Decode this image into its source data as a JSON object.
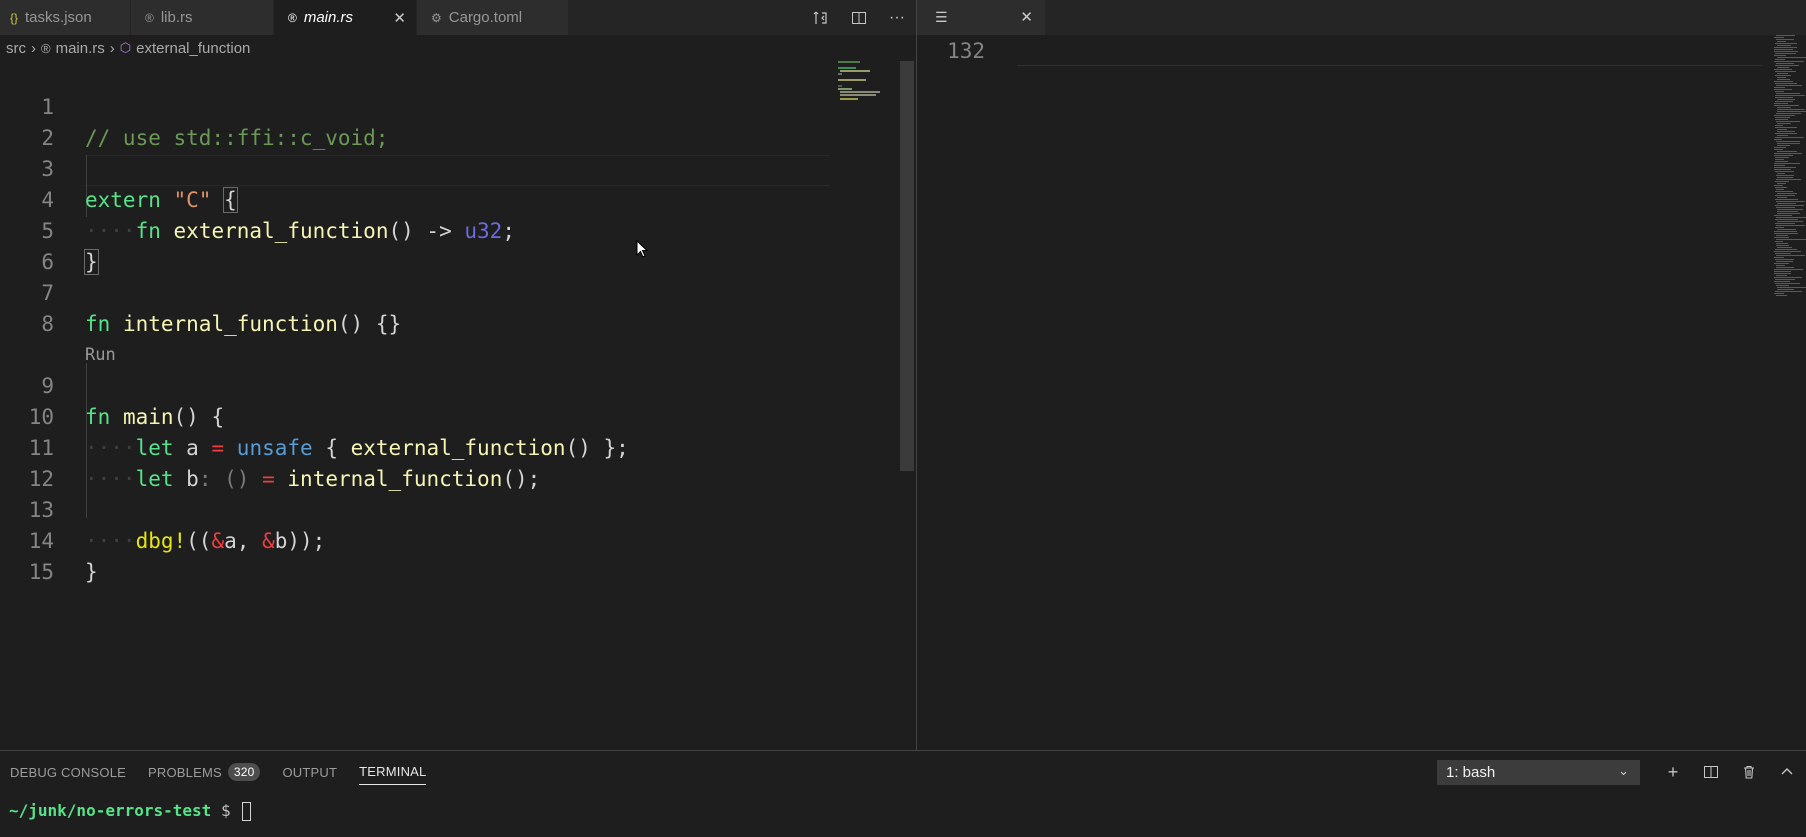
{
  "tabs": [
    {
      "label": "tasks.json",
      "icon": "{}"
    },
    {
      "label": "lib.rs",
      "icon": "rust-icon"
    },
    {
      "label": "main.rs",
      "icon": "rust-icon",
      "active": true
    },
    {
      "label": "Cargo.toml",
      "icon": "gear-icon"
    }
  ],
  "breadcrumb": {
    "folder": "src",
    "file": "main.rs",
    "symbol": "external_function"
  },
  "editor": {
    "codelens": "Run",
    "lines": [
      {
        "n": "1"
      },
      {
        "n": "2"
      },
      {
        "n": "3"
      },
      {
        "n": "4"
      },
      {
        "n": "5"
      },
      {
        "n": "6"
      },
      {
        "n": "7"
      },
      {
        "n": "8"
      },
      {
        "n": "9"
      },
      {
        "n": "10"
      },
      {
        "n": "11"
      },
      {
        "n": "12"
      },
      {
        "n": "13"
      },
      {
        "n": "14"
      },
      {
        "n": "15"
      }
    ]
  },
  "right_pane": {
    "line_number": "132"
  },
  "panel": {
    "tabs": [
      "DEBUG CONSOLE",
      "PROBLEMS",
      "OUTPUT",
      "TERMINAL"
    ],
    "problems_count": "320",
    "terminal_select": "1: bash",
    "terminal_path": "~/junk/no-errors-test",
    "terminal_prompt": "$"
  },
  "colors": {
    "keyword": "#57e389",
    "function": "#f6f5b4",
    "string": "#e0926b",
    "type": "#6b6bdc",
    "operator": "#f03e3e",
    "comment": "#6a9955"
  }
}
